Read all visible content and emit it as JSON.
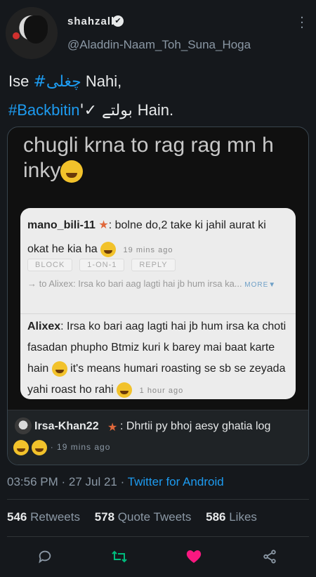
{
  "user": {
    "display_name": "shahzalb",
    "verified_mark": "✔",
    "handle": "@Aladdin-Naam_Toh_Suna_Hoga"
  },
  "tweet": {
    "line1_prefix": "Ise ",
    "hashtag1": "#چغلی",
    "line1_suffix": " Nahi,",
    "hashtag2": "#Backbitin",
    "line2_mid": "'✓ بولتے ",
    "line2_suffix": "Hain."
  },
  "media": {
    "caption": "chugli krna to rag rag mn h inky",
    "comment1_user": "mano_bili-11",
    "comment1_text": ": bolne do,2 take ki jahil aurat ki okat he kia ha",
    "comment1_time": "19 mins ago",
    "action_block": "BLOCK",
    "action_1on1": "1-ON-1",
    "action_reply": "REPLY",
    "reply_to_text": "→ to Alixex: Irsa ko bari aag lagti hai jb hum irsa ka...",
    "more_label": "MORE▼",
    "comment2_user": "Alixex",
    "comment2_text": ": Irsa ko bari aag lagti hai jb hum irsa ka choti fasadan phupho Btmiz kuri k barey mai baat karte hain",
    "comment2_text_b": " it's means humari roasting se sb se zeyada yahi roast ho rahi",
    "comment2_time": "1 hour ago",
    "comment3_user": "Irsa-Khan22",
    "comment3_text": ": Dhrtii py bhoj aesy ghatia log",
    "comment3_time": "· 19 mins ago"
  },
  "meta": {
    "time": "03:56 PM · 27 Jul 21 · ",
    "client": "Twitter for Android"
  },
  "stats": {
    "retweets_count": "546",
    "retweets_label": " Retweets",
    "quotes_count": "578",
    "quotes_label": " Quote Tweets",
    "likes_count": "586",
    "likes_label": " Likes"
  },
  "colors": {
    "accent": "#1d9bf0",
    "retweet": "#00ba7c",
    "like": "#f91880"
  },
  "icons": [
    "more-icon",
    "verified-icon",
    "reply-icon",
    "retweet-icon",
    "like-icon",
    "share-icon"
  ]
}
